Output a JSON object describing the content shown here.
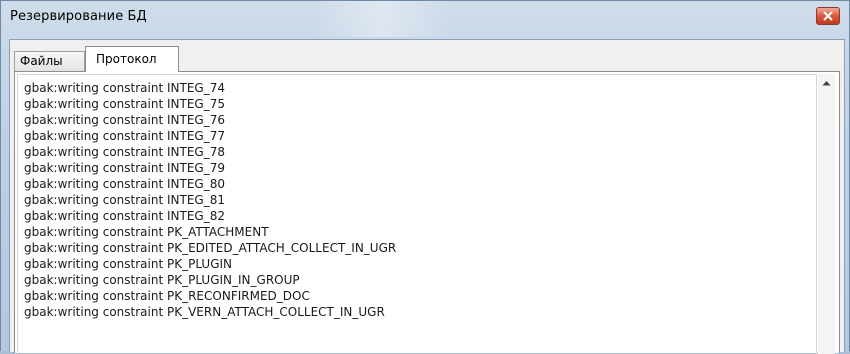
{
  "window": {
    "title": "Резервирование БД"
  },
  "tabs": [
    {
      "label": "Файлы",
      "active": false
    },
    {
      "label": "Протокол",
      "active": true
    }
  ],
  "log": {
    "lines": [
      "gbak:writing constraint INTEG_74",
      "gbak:writing constraint INTEG_75",
      "gbak:writing constraint INTEG_76",
      "gbak:writing constraint INTEG_77",
      "gbak:writing constraint INTEG_78",
      "gbak:writing constraint INTEG_79",
      "gbak:writing constraint INTEG_80",
      "gbak:writing constraint INTEG_81",
      "gbak:writing constraint INTEG_82",
      "gbak:writing constraint PK_ATTACHMENT",
      "gbak:writing constraint PK_EDITED_ATTACH_COLLECT_IN_UGR",
      "gbak:writing constraint PK_PLUGIN",
      "gbak:writing constraint PK_PLUGIN_IN_GROUP",
      "gbak:writing constraint PK_RECONFIRMED_DOC",
      "gbak:writing constraint PK_VERN_ATTACH_COLLECT_IN_UGR"
    ]
  },
  "icons": {
    "close": "close-icon",
    "scroll_up": "scroll-up-arrow-icon"
  },
  "colors": {
    "close_button": "#d8593d",
    "title_bar": "#bcd0e5"
  }
}
